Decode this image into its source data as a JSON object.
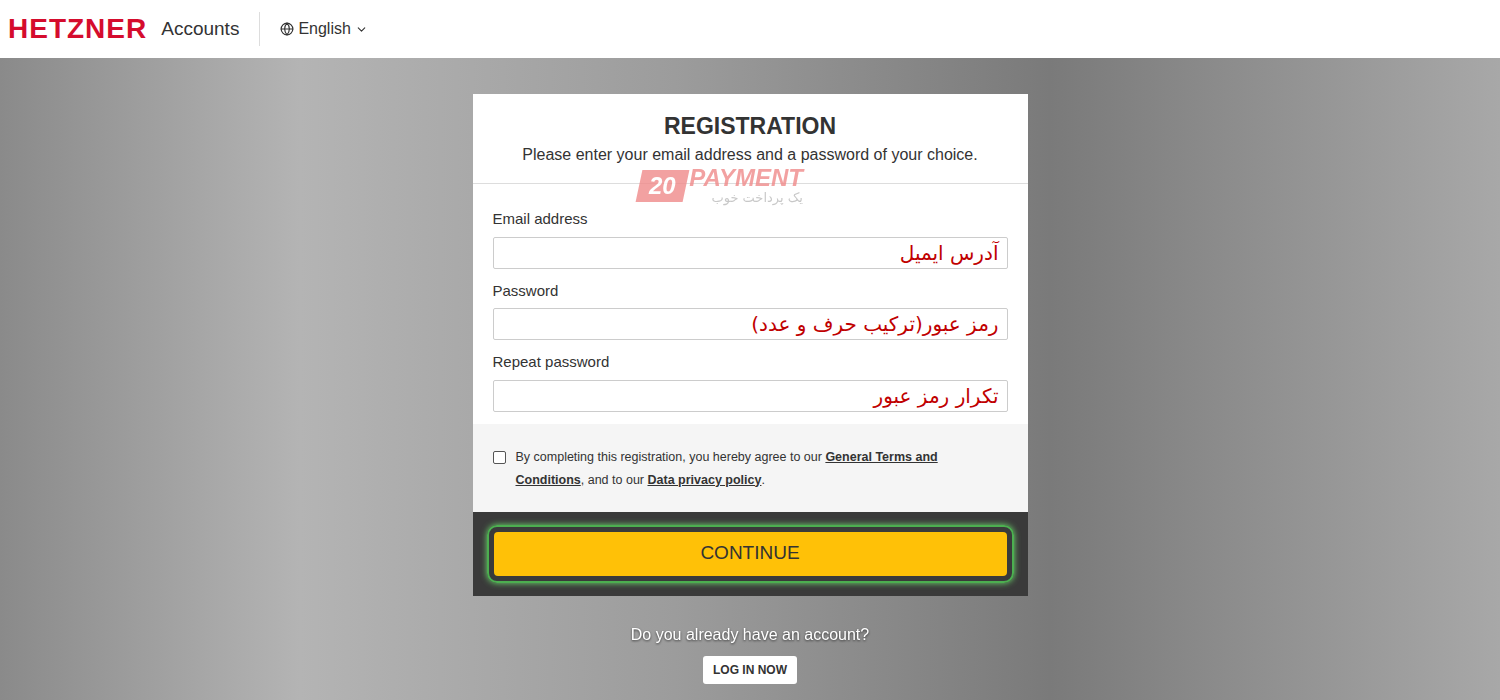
{
  "header": {
    "logo": "HETZNER",
    "app": "Accounts",
    "language": "English"
  },
  "card": {
    "title": "REGISTRATION",
    "subtitle": "Please enter your email address and a password of your choice.",
    "fields": [
      {
        "label": "Email address",
        "annotation": "آدرس ایمیل"
      },
      {
        "label": "Password",
        "annotation": "رمز عبور(ترکیب حرف و عدد)"
      },
      {
        "label": "Repeat password",
        "annotation": "تکرار رمز عبور"
      }
    ],
    "terms": {
      "checked": false,
      "parts": [
        {
          "text": "By completing this registration, you hereby agree to our ",
          "kind": "text"
        },
        {
          "text": "General Terms and Conditions",
          "kind": "link"
        },
        {
          "text": ", and to our ",
          "kind": "text"
        },
        {
          "text": "Data privacy policy",
          "kind": "link"
        },
        {
          "text": ".",
          "kind": "text"
        }
      ]
    },
    "button": {
      "label": "CONTINUE",
      "highlighted": true
    }
  },
  "watermark": {
    "number": "20",
    "brand": "PAYMENT",
    "tagline": "یک پرداخت خوب"
  },
  "login": {
    "prompt": "Do you already have an account?",
    "button": "LOG IN NOW"
  }
}
